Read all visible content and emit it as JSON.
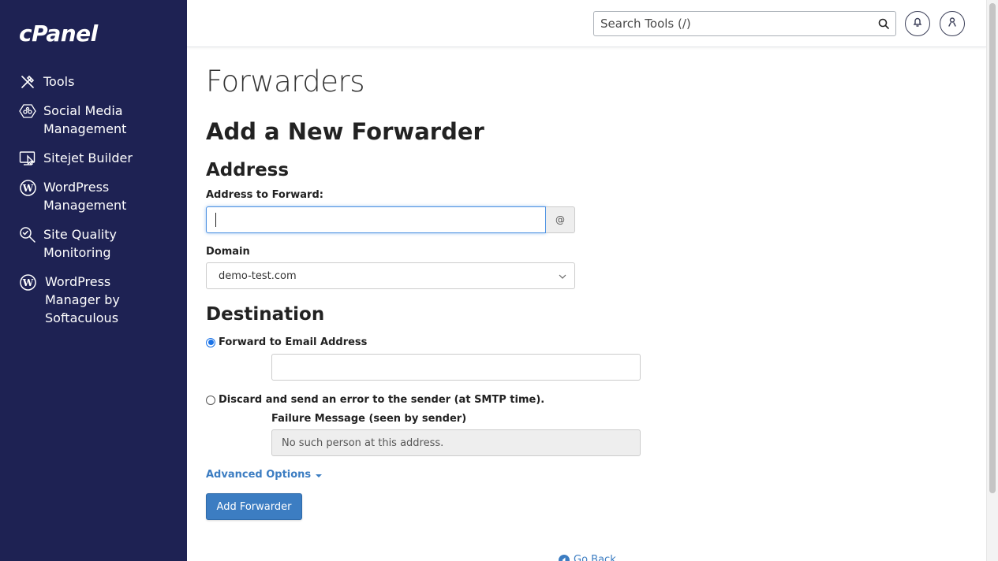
{
  "brand": {
    "logo_text": "cPanel"
  },
  "sidebar": {
    "items": [
      {
        "label": "Tools",
        "icon": "tools-icon"
      },
      {
        "label": "Social Media Management",
        "icon": "social-media-icon"
      },
      {
        "label": "Sitejet Builder",
        "icon": "sitejet-icon"
      },
      {
        "label": "WordPress Management",
        "icon": "wordpress-icon"
      },
      {
        "label": "Site Quality Monitoring",
        "icon": "site-quality-icon"
      },
      {
        "label": "WordPress Manager by Softaculous",
        "icon": "wordpress-icon"
      }
    ],
    "background": "#1e2253"
  },
  "header": {
    "search_placeholder": "Search Tools (/)",
    "search_icon": "search-icon",
    "notifications_icon": "bell-icon",
    "user_icon": "user-icon"
  },
  "main": {
    "page_title": "Forwarders",
    "form_title": "Add a New Forwarder",
    "address_section": {
      "heading": "Address",
      "address_label": "Address to Forward:",
      "address_value": "",
      "at_symbol": "@",
      "domain_label": "Domain",
      "domain_selected": "demo-test.com"
    },
    "destination_section": {
      "heading": "Destination",
      "forward_option_label": "Forward to Email Address",
      "forward_option_checked": true,
      "forward_email_value": "",
      "discard_option_label": "Discard and send an error to the sender (at SMTP time).",
      "discard_option_checked": false,
      "failure_message_label": "Failure Message (seen by sender)",
      "failure_message_value": "No such person at this address."
    },
    "advanced_options_label": "Advanced Options",
    "submit_label": "Add Forwarder",
    "go_back_label": "Go Back"
  },
  "colors": {
    "accent": "#3c7dc2",
    "sidebar": "#1e2253",
    "focus_border": "#4a90e2"
  }
}
